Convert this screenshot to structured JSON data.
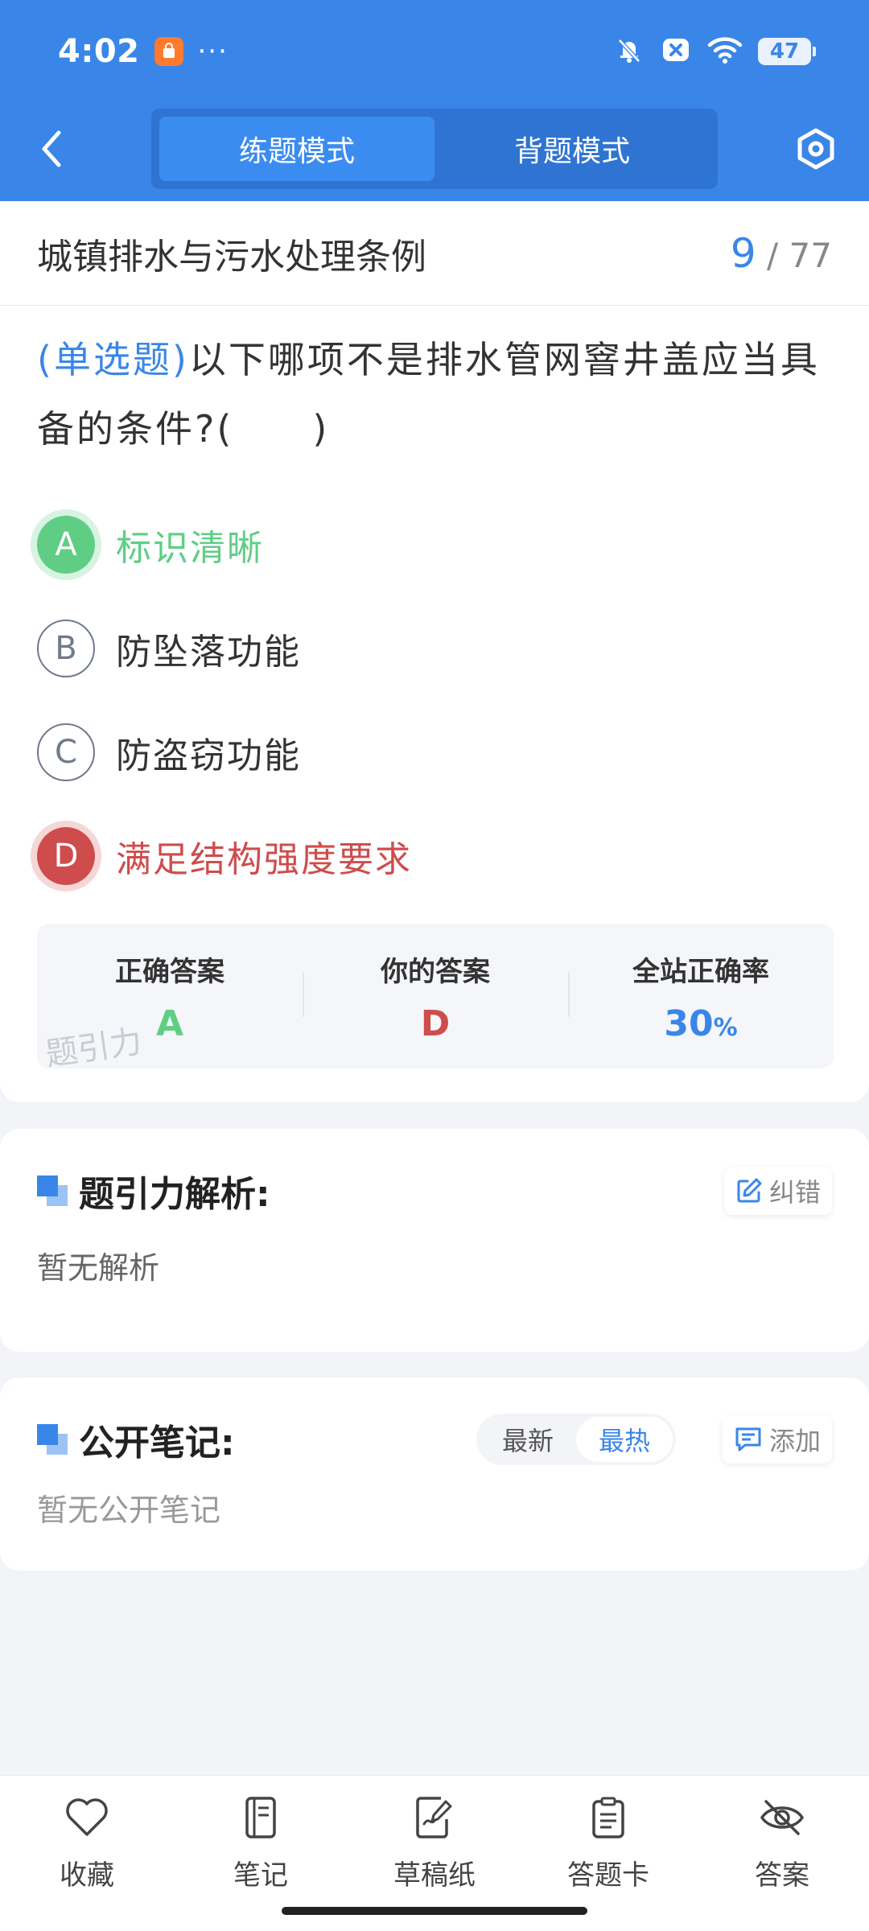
{
  "status_bar": {
    "time": "4:02",
    "more": "···",
    "battery": "47"
  },
  "header": {
    "tabs": [
      {
        "label": "练题模式",
        "active": true
      },
      {
        "label": "背题模式",
        "active": false
      }
    ]
  },
  "title_bar": {
    "chapter": "城镇排水与污水处理条例",
    "current": "9",
    "separator": " / ",
    "total": "77"
  },
  "question": {
    "type": "(单选题)",
    "text": "以下哪项不是排水管网窨井盖应当具备的条件?(　　)",
    "options": [
      {
        "key": "A",
        "text": "标识清晰",
        "state": "correct"
      },
      {
        "key": "B",
        "text": "防坠落功能",
        "state": "normal"
      },
      {
        "key": "C",
        "text": "防盗窃功能",
        "state": "normal"
      },
      {
        "key": "D",
        "text": "满足结构强度要求",
        "state": "wrong"
      }
    ]
  },
  "answer_summary": {
    "correct_label": "正确答案",
    "correct_value": "A",
    "yours_label": "你的答案",
    "yours_value": "D",
    "rate_label": "全站正确率",
    "rate_value": "30",
    "rate_unit": "%",
    "watermark": "题引力"
  },
  "analysis": {
    "title": "题引力解析:",
    "correct_button": "纠错",
    "body": "暂无解析"
  },
  "notes": {
    "title": "公开笔记:",
    "sort_options": [
      "最新",
      "最热"
    ],
    "active_sort": "最热",
    "add_button": "添加",
    "body": "暂无公开笔记"
  },
  "bottom_nav": [
    {
      "label": "收藏",
      "icon": "heart-icon"
    },
    {
      "label": "笔记",
      "icon": "notebook-icon"
    },
    {
      "label": "草稿纸",
      "icon": "draft-paper-icon"
    },
    {
      "label": "答题卡",
      "icon": "answer-card-icon"
    },
    {
      "label": "答案",
      "icon": "eye-off-icon"
    }
  ],
  "colors": {
    "primary": "#3a86e8",
    "correct": "#5fce84",
    "wrong": "#cf4c4c"
  }
}
